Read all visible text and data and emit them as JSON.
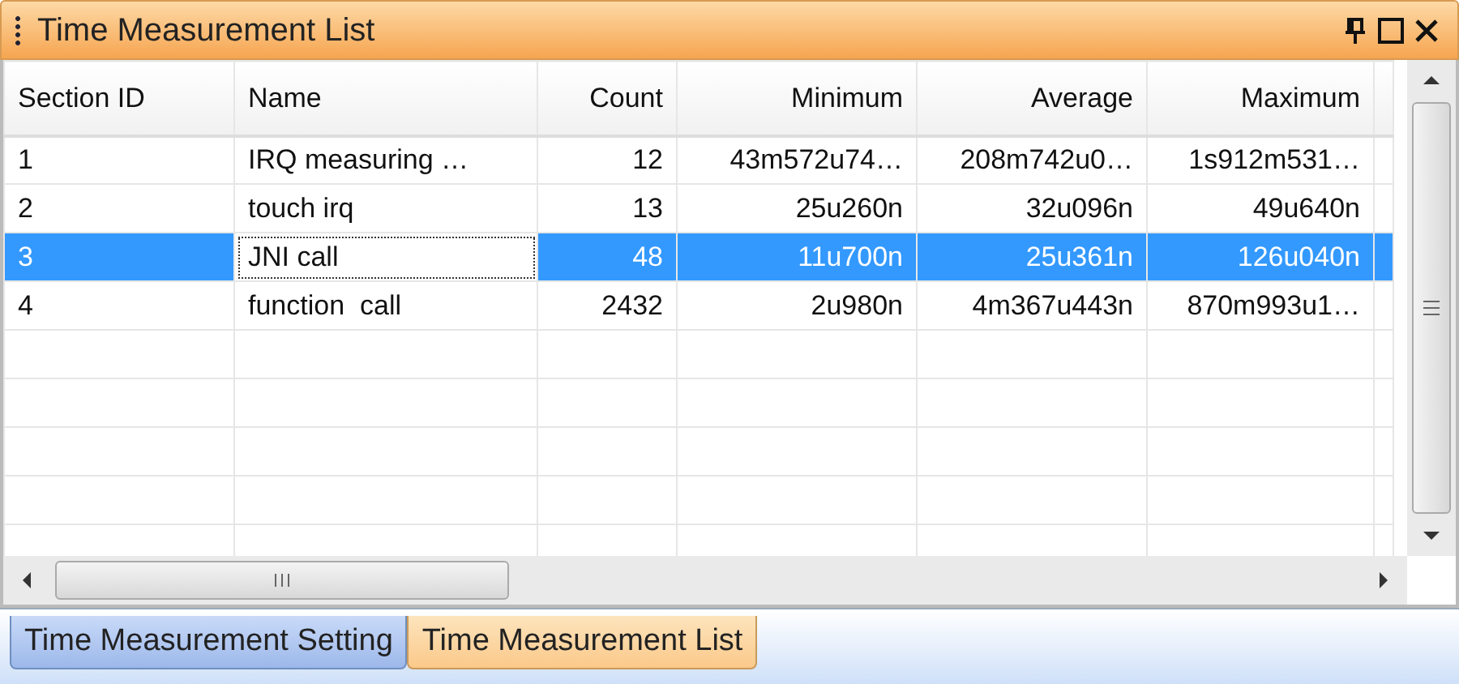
{
  "panel": {
    "title": "Time Measurement List"
  },
  "table": {
    "columns": [
      "Section ID",
      "Name",
      "Count",
      "Minimum",
      "Average",
      "Maximum"
    ],
    "rows": [
      {
        "cells": [
          "1",
          "IRQ measuring …",
          "12",
          "43m572u74…",
          "208m742u0…",
          "1s912m531…"
        ],
        "selected": false,
        "focused": false
      },
      {
        "cells": [
          "2",
          "touch irq",
          "13",
          "25u260n",
          "32u096n",
          "49u640n"
        ],
        "selected": false,
        "focused": false
      },
      {
        "cells": [
          "3",
          "JNI call",
          "48",
          "11u700n",
          "25u361n",
          "126u040n"
        ],
        "selected": true,
        "focused": true
      },
      {
        "cells": [
          "4",
          "function  call",
          "2432",
          "2u980n",
          "4m367u443n",
          "870m993u1…"
        ],
        "selected": false,
        "focused": false
      }
    ]
  },
  "tabs": [
    {
      "label": "Time Measurement Setting",
      "selected": false
    },
    {
      "label": "Time Measurement List",
      "selected": true
    }
  ]
}
